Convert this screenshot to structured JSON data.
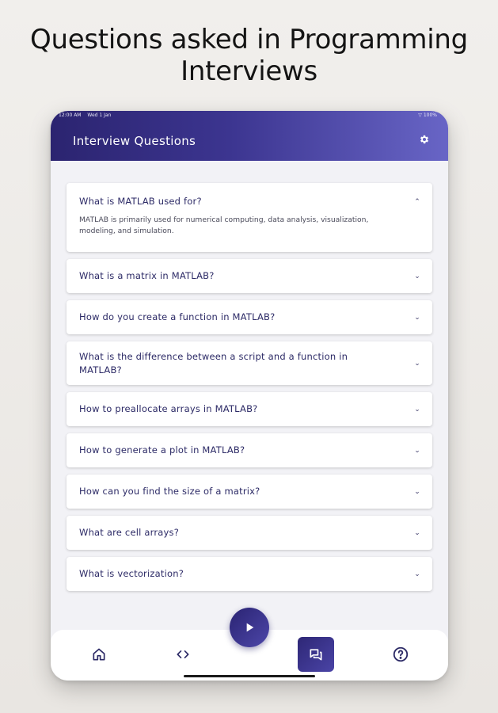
{
  "headline": {
    "line1": "Questions asked in Programming",
    "line2": "Interviews"
  },
  "statusbar": {
    "time": "12:00 AM",
    "date": "Wed 1 Jan",
    "battery": "100%"
  },
  "appbar": {
    "title": "Interview Questions",
    "settings_icon": "gear-icon"
  },
  "questions": [
    {
      "question": "What is MATLAB used for?",
      "expanded": true,
      "answer": "MATLAB is primarily used for numerical computing, data analysis, visualization, modeling, and simulation."
    },
    {
      "question": "What is a matrix in MATLAB?",
      "expanded": false
    },
    {
      "question": "How do you create a function in MATLAB?",
      "expanded": false
    },
    {
      "question": "What is the difference between a script and a function in MATLAB?",
      "expanded": false
    },
    {
      "question": "How to preallocate arrays in MATLAB?",
      "expanded": false
    },
    {
      "question": "How to generate a plot in MATLAB?",
      "expanded": false
    },
    {
      "question": "How can you find the size of a matrix?",
      "expanded": false
    },
    {
      "question": "What are cell arrays?",
      "expanded": false
    },
    {
      "question": "What is vectorization?",
      "expanded": false
    }
  ],
  "bottomnav": {
    "items": [
      "home-icon",
      "code-icon",
      "play-icon",
      "chat-icon",
      "help-icon"
    ],
    "active": "chat-icon"
  },
  "colors": {
    "primary_dark": "#2b2470",
    "primary_light": "#6865c6",
    "question_text": "#2c2a66",
    "background": "#f2f2f6"
  }
}
